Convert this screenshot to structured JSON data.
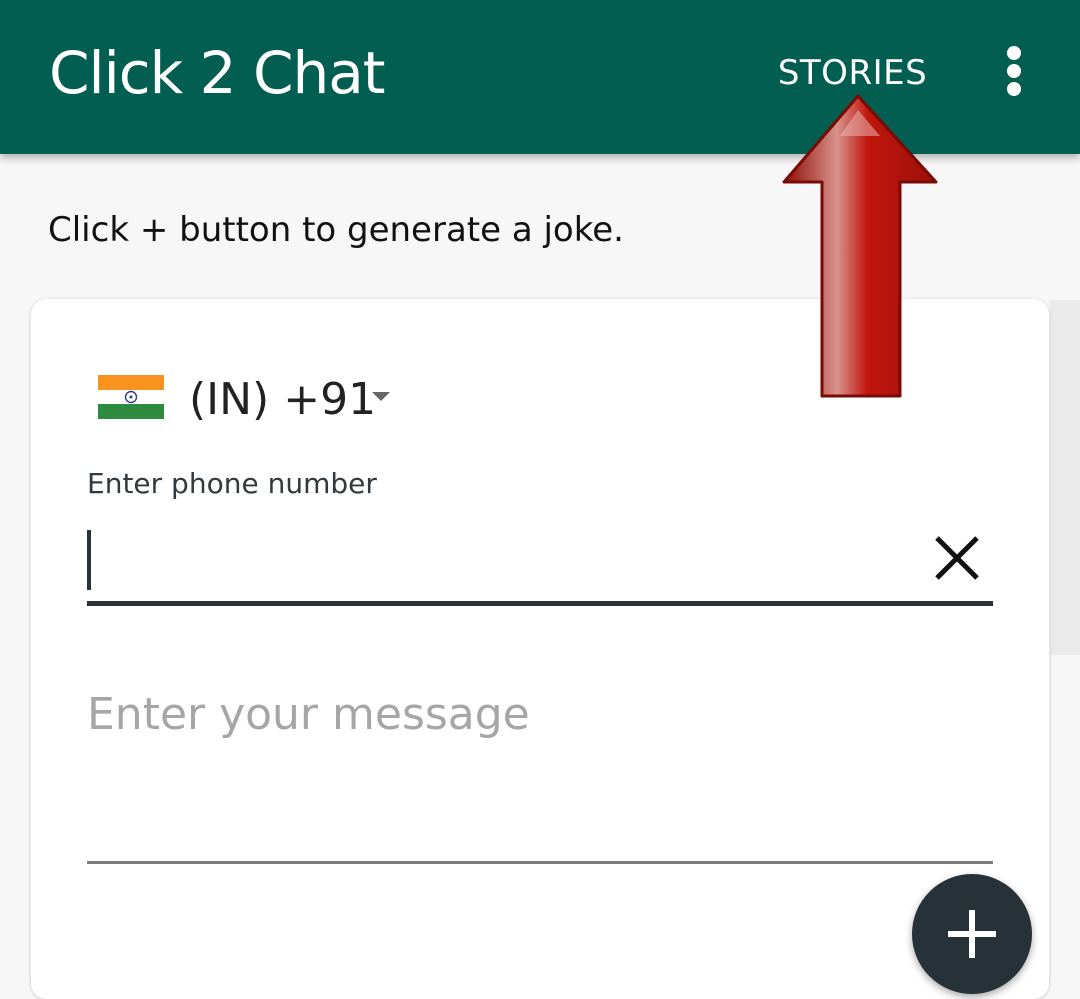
{
  "app_bar": {
    "title": "Click 2 Chat",
    "stories_label": "STORIES",
    "overflow_icon": "more-vert-icon",
    "background_color": "#025e51"
  },
  "hint": {
    "text": "Click + button to generate a joke."
  },
  "form": {
    "country": {
      "flag_icon": "india-flag-icon",
      "label": "(IN)  +91",
      "dropdown_icon": "arrow-drop-down-icon"
    },
    "phone": {
      "label": "Enter phone number",
      "value": "",
      "clear_icon": "close-icon"
    },
    "message": {
      "placeholder": "Enter your message",
      "value": ""
    }
  },
  "fab": {
    "icon": "plus-icon",
    "color": "#263238"
  },
  "annotation": {
    "icon": "red-up-arrow-icon",
    "color": "#c0160d"
  }
}
